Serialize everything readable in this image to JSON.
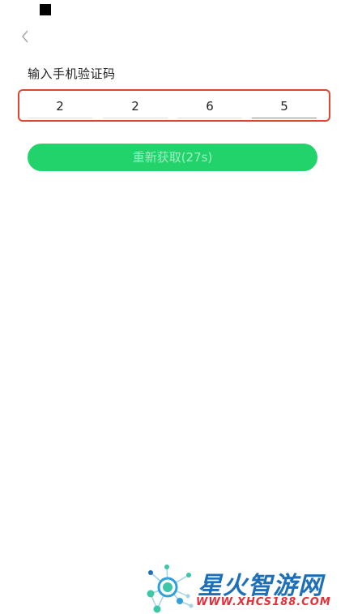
{
  "header": {
    "back_icon": "chevron-left-icon"
  },
  "verify": {
    "title": "输入手机验证码",
    "digits": [
      "2",
      "2",
      "6",
      "5"
    ],
    "resend_label": "重新获取(27s)"
  },
  "watermark": {
    "brand": "星火智游网",
    "url": "WWW.XHCS188.COM"
  },
  "colors": {
    "accent": "#22d36c",
    "highlight": "#e0452f",
    "watermark_brand": "#1d6fb8",
    "watermark_url": "#e2303a"
  }
}
